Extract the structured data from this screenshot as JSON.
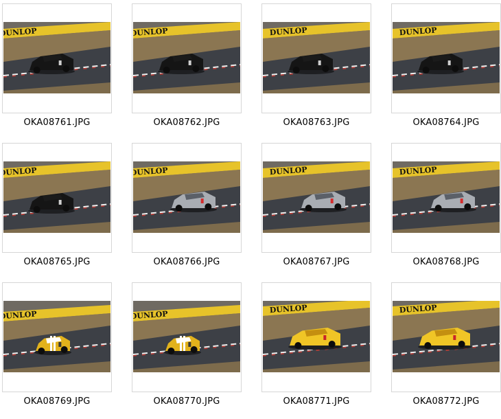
{
  "gallery": {
    "items": [
      {
        "filename": "OKA08761.JPG",
        "subject": "black-sports-car",
        "car_color": "#151515",
        "accent": "#1b1b1b",
        "detail": "#cfcfcf"
      },
      {
        "filename": "OKA08762.JPG",
        "subject": "black-sports-car",
        "car_color": "#151515",
        "accent": "#1b1b1b",
        "detail": "#cfcfcf"
      },
      {
        "filename": "OKA08763.JPG",
        "subject": "black-sports-car",
        "car_color": "#151515",
        "accent": "#1b1b1b",
        "detail": "#cfcfcf"
      },
      {
        "filename": "OKA08764.JPG",
        "subject": "black-sports-car",
        "car_color": "#151515",
        "accent": "#1b1b1b",
        "detail": "#cfcfcf"
      },
      {
        "filename": "OKA08765.JPG",
        "subject": "black-sports-car",
        "car_color": "#151515",
        "accent": "#1b1b1b",
        "detail": "#cfcfcf"
      },
      {
        "filename": "OKA08766.JPG",
        "subject": "silver-roadster",
        "car_color": "#a9adb3",
        "accent": "#5b6068",
        "detail": "#d52c2c"
      },
      {
        "filename": "OKA08767.JPG",
        "subject": "silver-roadster",
        "car_color": "#a9adb3",
        "accent": "#5b6068",
        "detail": "#d52c2c"
      },
      {
        "filename": "OKA08768.JPG",
        "subject": "silver-roadster",
        "car_color": "#a9adb3",
        "accent": "#5b6068",
        "detail": "#d52c2c"
      },
      {
        "filename": "OKA08769.JPG",
        "subject": "yellow-coupe",
        "car_color": "#e2b21c",
        "accent": "#ffffff",
        "detail": "#3a3a3a"
      },
      {
        "filename": "OKA08770.JPG",
        "subject": "yellow-coupe",
        "car_color": "#e2b21c",
        "accent": "#ffffff",
        "detail": "#3a3a3a"
      },
      {
        "filename": "OKA08771.JPG",
        "subject": "yellow-roadster",
        "car_color": "#f0c526",
        "accent": "#c48f10",
        "detail": "#c9242a"
      },
      {
        "filename": "OKA08772.JPG",
        "subject": "yellow-roadster",
        "car_color": "#f0c526",
        "accent": "#c48f10",
        "detail": "#c9242a"
      }
    ],
    "banner_text": "DUNLOP",
    "colors": {
      "asphalt": "#3d4046",
      "banner": "#e7c32a",
      "banner_text": "#111111",
      "grass": "#8b7652",
      "kerb_red": "#c23a33",
      "kerb_white": "#efefef",
      "frame_border": "#d6d6d6"
    }
  }
}
